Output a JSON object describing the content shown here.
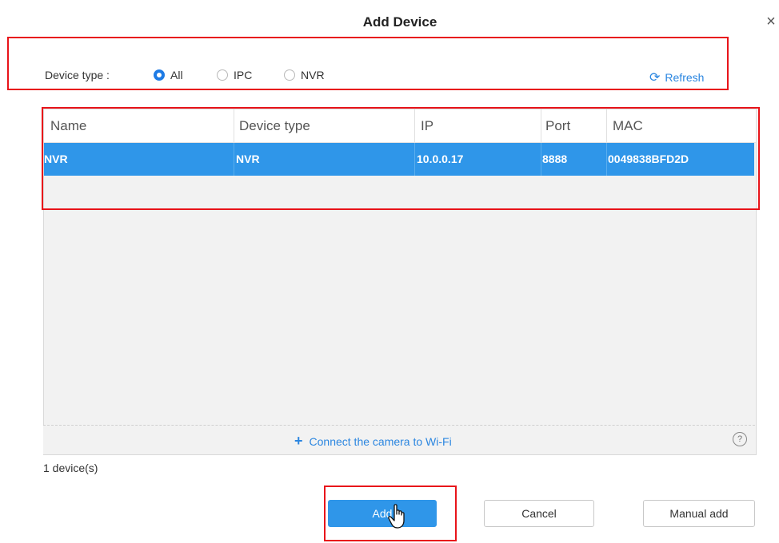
{
  "dialog": {
    "title": "Add Device",
    "close_icon": "close-icon"
  },
  "filter": {
    "label": "Device type :",
    "options": [
      {
        "label": "All",
        "checked": true
      },
      {
        "label": "IPC",
        "checked": false
      },
      {
        "label": "NVR",
        "checked": false
      }
    ],
    "refresh_label": "Refresh",
    "refresh_icon": "refresh-icon"
  },
  "table": {
    "columns": [
      "Name",
      "Device type",
      "IP",
      "Port",
      "MAC"
    ],
    "rows": [
      {
        "name": "NVR",
        "device_type": "NVR",
        "ip": "10.0.0.17",
        "port": "8888",
        "mac": "0049838BFD2D",
        "selected": true
      }
    ]
  },
  "wifi": {
    "label": "Connect the camera to Wi-Fi",
    "help_icon": "help-icon"
  },
  "status": {
    "count_text": "1 device(s)"
  },
  "buttons": {
    "add": "Add",
    "cancel": "Cancel",
    "manual_add": "Manual add"
  },
  "colors": {
    "accent": "#2f96e9",
    "link": "#2b86e0",
    "highlight_box": "#e8141a"
  }
}
